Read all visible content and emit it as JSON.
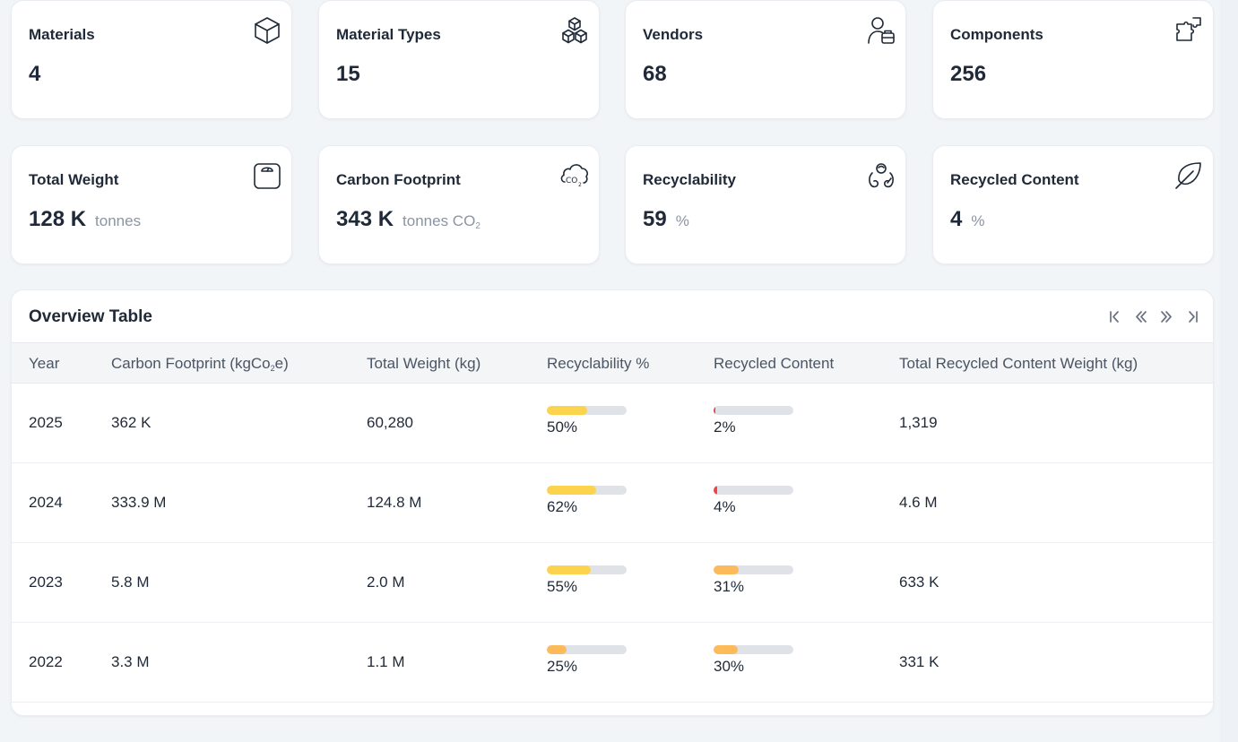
{
  "stats": [
    {
      "title": "Materials",
      "value": "4",
      "unit": "",
      "icon": "cube-icon"
    },
    {
      "title": "Material Types",
      "value": "15",
      "unit": "",
      "icon": "cubes-icon"
    },
    {
      "title": "Vendors",
      "value": "68",
      "unit": "",
      "icon": "vendor-icon"
    },
    {
      "title": "Components",
      "value": "256",
      "unit": "",
      "icon": "puzzle-icon"
    },
    {
      "title": "Total Weight",
      "value": "128 K",
      "unit": "tonnes",
      "icon": "scale-icon"
    },
    {
      "title": "Carbon Footprint",
      "value": "343 K",
      "unit": "tonnes CO",
      "unit_sub": "2",
      "icon": "co2-cloud-icon"
    },
    {
      "title": "Recyclability",
      "value": "59",
      "unit": "%",
      "icon": "recycle-hands-icon"
    },
    {
      "title": "Recycled Content",
      "value": "4",
      "unit": "%",
      "icon": "leaf-icon"
    }
  ],
  "table": {
    "title": "Overview Table",
    "pager": [
      "first-page-icon",
      "previous-page-icon",
      "next-page-icon",
      "last-page-icon"
    ],
    "headers": {
      "year": "Year",
      "carbon_pre": "Carbon Footprint (kgCo",
      "carbon_sub": "2",
      "carbon_post": "e)",
      "weight": "Total Weight (kg)",
      "recyclability": "Recyclability %",
      "recycled": "Recycled Content",
      "recycled_weight": "Total Recycled Content Weight (kg)"
    },
    "rows": [
      {
        "year": "2025",
        "carbon": "362 K",
        "weight": "60,280",
        "recyclability": 50,
        "recyclability_label": "50%",
        "recyclability_color": "#fcd34d",
        "recycled": 2,
        "recycled_label": "2%",
        "recycled_color": "#ef4444",
        "recycled_weight": "1,319"
      },
      {
        "year": "2024",
        "carbon": "333.9 M",
        "weight": "124.8 M",
        "recyclability": 62,
        "recyclability_label": "62%",
        "recyclability_color": "#fcd34d",
        "recycled": 4,
        "recycled_label": "4%",
        "recycled_color": "#ef4444",
        "recycled_weight": "4.6 M"
      },
      {
        "year": "2023",
        "carbon": "5.8 M",
        "weight": "2.0 M",
        "recyclability": 55,
        "recyclability_label": "55%",
        "recyclability_color": "#fcd34d",
        "recycled": 31,
        "recycled_label": "31%",
        "recycled_color": "#fdba5b",
        "recycled_weight": "633 K"
      },
      {
        "year": "2022",
        "carbon": "3.3 M",
        "weight": "1.1 M",
        "recyclability": 25,
        "recyclability_label": "25%",
        "recyclability_color": "#fdba5b",
        "recycled": 30,
        "recycled_label": "30%",
        "recycled_color": "#fdba5b",
        "recycled_weight": "331 K"
      }
    ]
  }
}
